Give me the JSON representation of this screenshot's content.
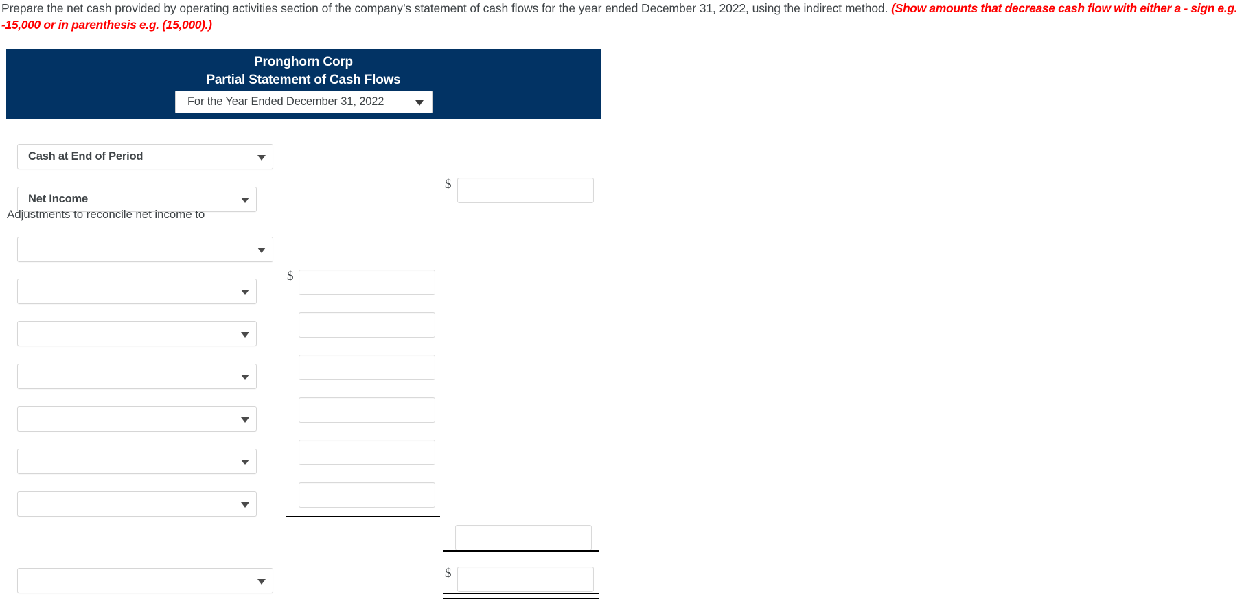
{
  "instructions": {
    "main": "Prepare the net cash provided by operating activities section of the company’s statement of cash flows for the year ended December 31, 2022, using the indirect method. ",
    "hint": "(Show amounts that decrease cash flow with either a - sign e.g. -15,000 or in parenthesis e.g. (15,000).)"
  },
  "statement": {
    "company": "Pronghorn Corp",
    "title": "Partial Statement of Cash Flows",
    "period_select": {
      "value": "For the Year Ended December 31, 2022",
      "caret": "chevron-down-icon"
    }
  },
  "rows": [
    {
      "id": "cash-at-end-of-period",
      "select_value": "Cash at End of Period",
      "select_placeholder": "",
      "amount_value": "",
      "dollar": ""
    },
    {
      "id": "net-income",
      "select_value": "Net Income",
      "select_placeholder": "",
      "amount_value": "",
      "dollar": "$"
    },
    {
      "id": "adjustments-caption",
      "text": "Adjustments to reconcile net income to"
    },
    {
      "id": "adjustment-row-1",
      "select_value": "",
      "select_placeholder": "",
      "amount_value": "",
      "dollar": ""
    },
    {
      "id": "adjustment-row-2",
      "select_value": "",
      "select_placeholder": "",
      "amount_value": "",
      "dollar": "$"
    },
    {
      "id": "adjustment-row-3",
      "select_value": "",
      "select_placeholder": "",
      "amount_value": "",
      "dollar": ""
    },
    {
      "id": "adjustment-row-4",
      "select_value": "",
      "select_placeholder": "",
      "amount_value": "",
      "dollar": ""
    },
    {
      "id": "adjustment-row-5",
      "select_value": "",
      "select_placeholder": "",
      "amount_value": "",
      "dollar": ""
    },
    {
      "id": "adjustment-row-6",
      "select_value": "",
      "select_placeholder": "",
      "amount_value": "",
      "dollar": ""
    },
    {
      "id": "adjustment-row-7",
      "select_value": "",
      "select_placeholder": "",
      "amount_value": "",
      "dollar": ""
    },
    {
      "id": "subtotal-row",
      "select_value": "",
      "amount_value": "",
      "dollar": ""
    },
    {
      "id": "net-cash-row",
      "select_value": "",
      "select_placeholder": "",
      "amount_value": "",
      "dollar": "$"
    }
  ],
  "colors": {
    "header_navy": "#023364",
    "hint_red": "#ff0000",
    "text_gray": "#3f4447",
    "border_gray": "#d6d6d6"
  }
}
